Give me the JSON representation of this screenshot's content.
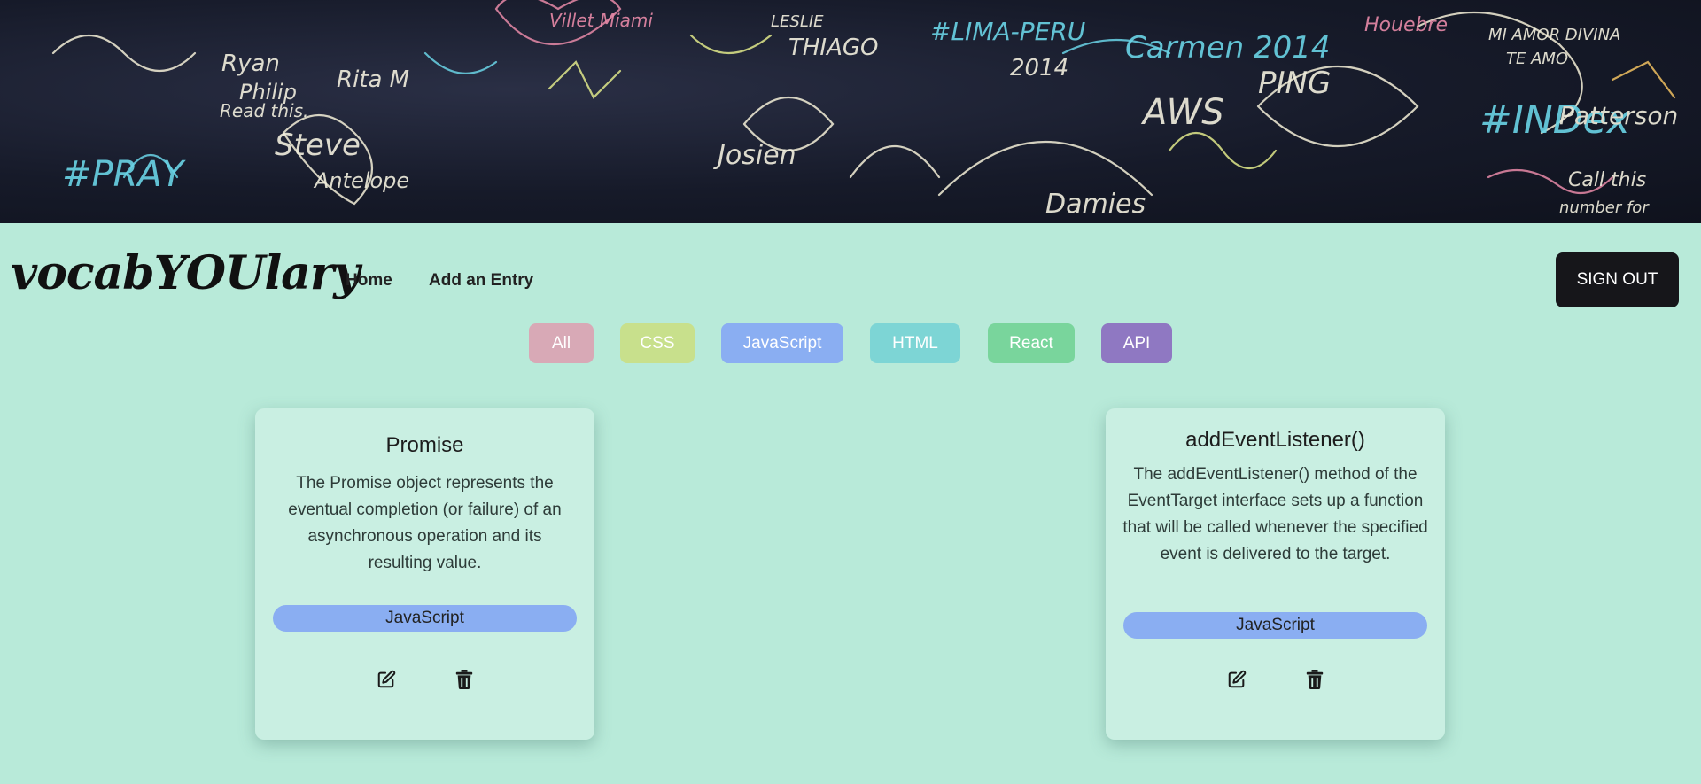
{
  "banner": {
    "scribbles": [
      "Ryan",
      "Philip",
      "Rita M",
      "Read this",
      "#PRAY",
      "Steve",
      "Antelope",
      "THIAGO",
      "Villet Miami",
      "Josien",
      "#LIMA-PERU",
      "2014",
      "Carmen 2014",
      "PING",
      "AWS",
      "#INDex",
      "Patterson",
      "Call this number for",
      "MI AMOR DIVINA",
      "TE AMO",
      "Damies",
      "Houebre",
      "LESLIE"
    ]
  },
  "nav": {
    "logo": "vocabYOUlary",
    "home": "Home",
    "add_entry": "Add an Entry",
    "sign_out": "SIGN OUT"
  },
  "filters": [
    {
      "label": "All",
      "color": "#d8a9b6"
    },
    {
      "label": "CSS",
      "color": "#c8e08c"
    },
    {
      "label": "JavaScript",
      "color": "#8aaef2"
    },
    {
      "label": "HTML",
      "color": "#7dd5d5"
    },
    {
      "label": "React",
      "color": "#79d59c"
    },
    {
      "label": "API",
      "color": "#8f78c2"
    }
  ],
  "cards": [
    {
      "title": "Promise",
      "description": "The Promise object represents the eventual completion (or failure) of an asynchronous operation and its resulting value.",
      "tag": "JavaScript",
      "edit_icon": "edit-icon",
      "delete_icon": "trash-icon"
    },
    {
      "title": "addEventListener()",
      "description": "The addEventListener() method of the EventTarget interface sets up a function that will be called whenever the specified event is delivered to the target.",
      "tag": "JavaScript",
      "edit_icon": "edit-icon",
      "delete_icon": "trash-icon"
    }
  ]
}
